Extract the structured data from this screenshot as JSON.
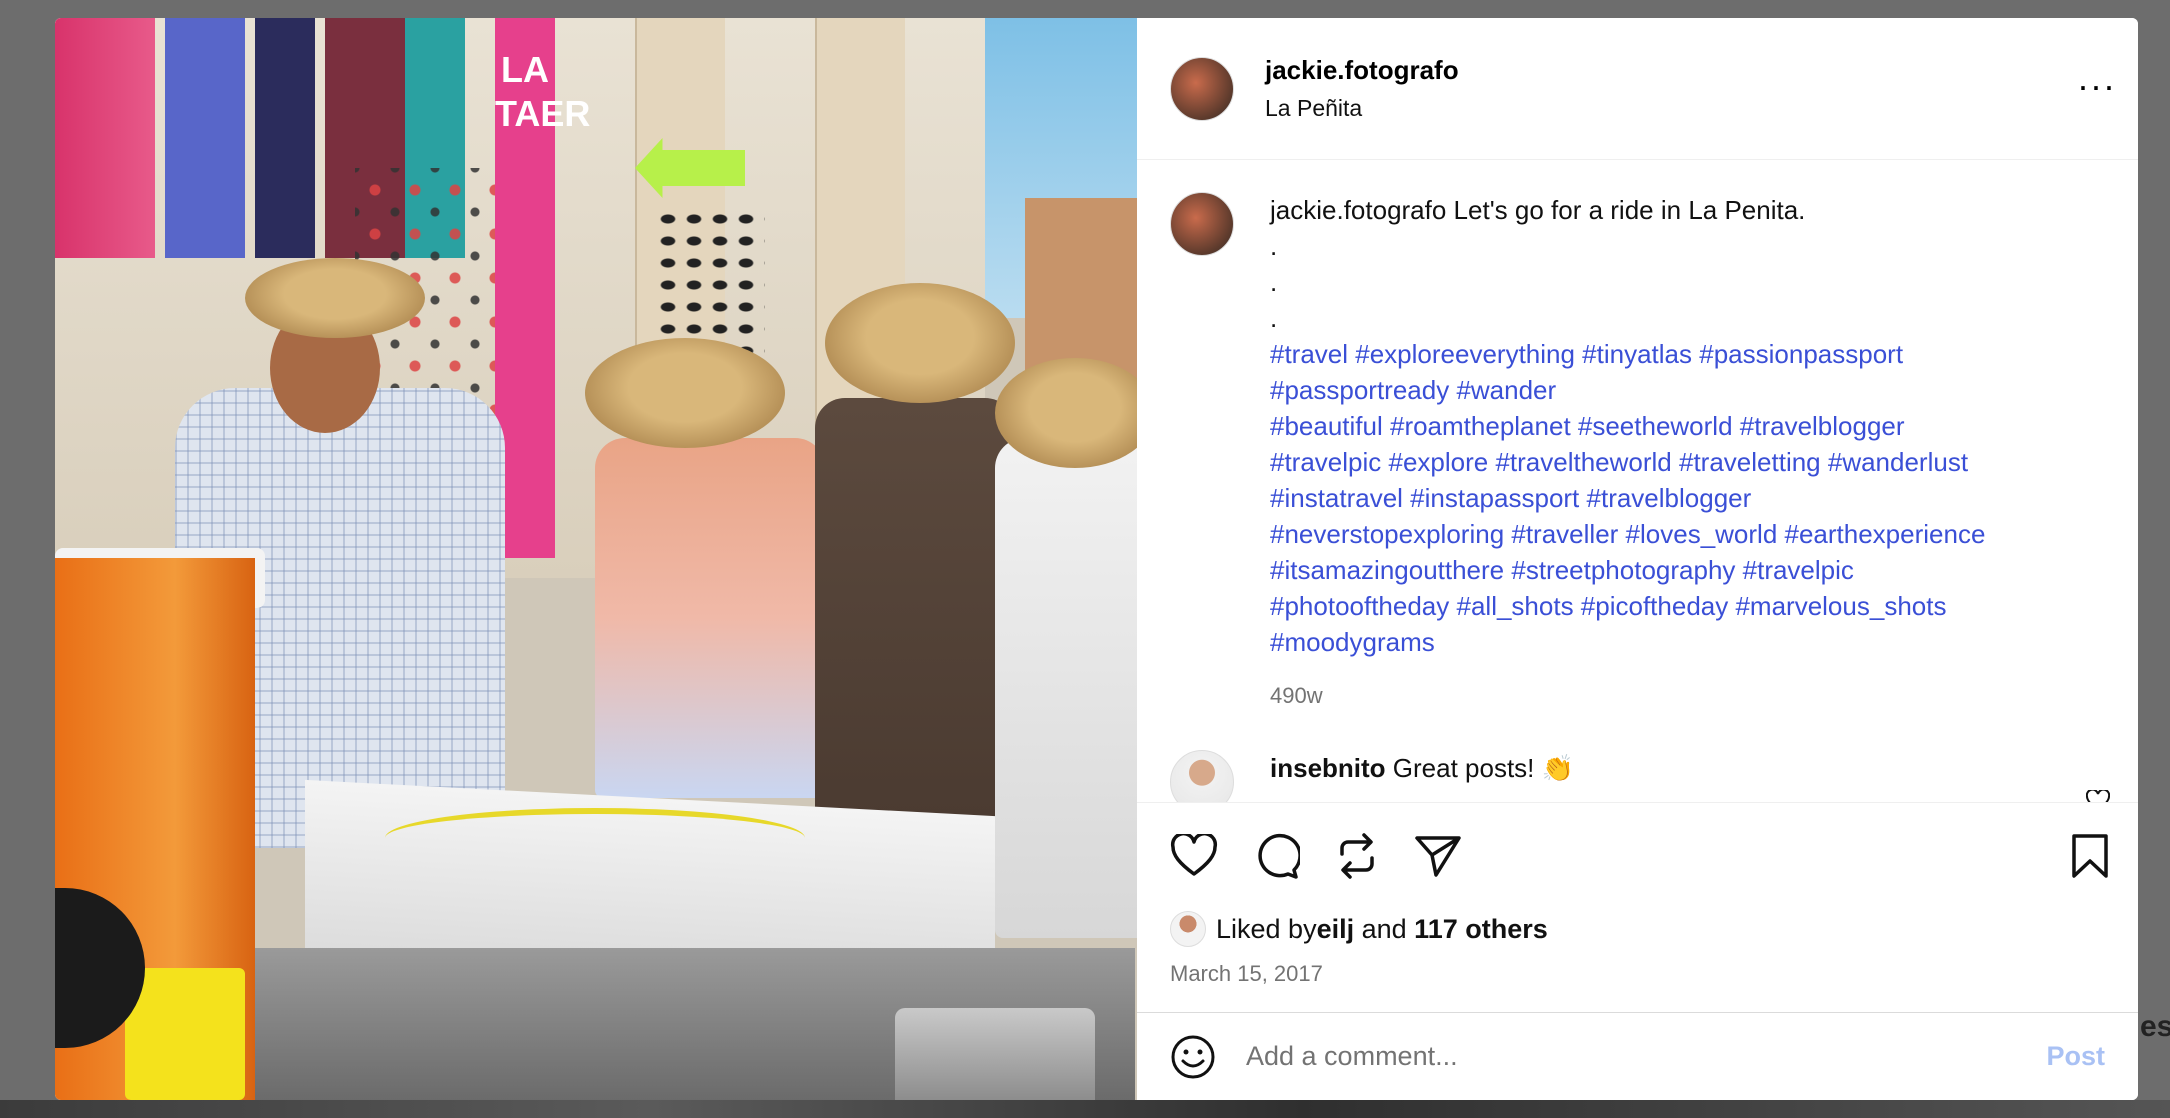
{
  "post": {
    "author": "jackie.fotografo",
    "location": "La Peñita",
    "more_icon": "more-horizontal-icon",
    "photo": {
      "sign_text": "LA TAER",
      "description_icon": "photo"
    }
  },
  "caption": {
    "username": "jackie.fotografo",
    "text": " Let's go for a ride in La Penita.",
    "dots": [
      ".",
      ".",
      "."
    ],
    "hashtag_lines": [
      "#travel #exploreeverything #tinyatlas #passionpassport",
      "#passportready #wander",
      "#beautiful #roamtheplanet #seetheworld #travelblogger",
      "#travelpic #explore #traveltheworld #traveletting #wanderlust",
      "#instatravel #instapassport #travelblogger",
      "#neverstopexploring #traveller #loves_world #earthexperience",
      "#itsamazingoutthere #streetphotography #travelpic",
      "#photooftheday #all_shots #picoftheday #marvelous_shots",
      "#moodygrams"
    ],
    "time": "490w"
  },
  "comments": [
    {
      "username": "insebnito",
      "text": " Great posts! 👏"
    }
  ],
  "actions": {
    "like_icon": "heart-icon",
    "comment_icon": "comment-icon",
    "repost_icon": "repost-icon",
    "share_icon": "send-icon",
    "save_icon": "bookmark-icon"
  },
  "likes": {
    "prefix": "Liked by ",
    "user": "eilj",
    "middle": " and ",
    "others": "117 others"
  },
  "date": "March 15, 2017",
  "comment_box": {
    "placeholder": "Add a comment...",
    "post_label": "Post",
    "emoji_icon": "smiley-icon"
  },
  "background_peek_text": "es",
  "colors": {
    "hashtag": "#3a4fd6",
    "post_button_disabled": "#a9c1f4",
    "muted_text": "#737373"
  }
}
